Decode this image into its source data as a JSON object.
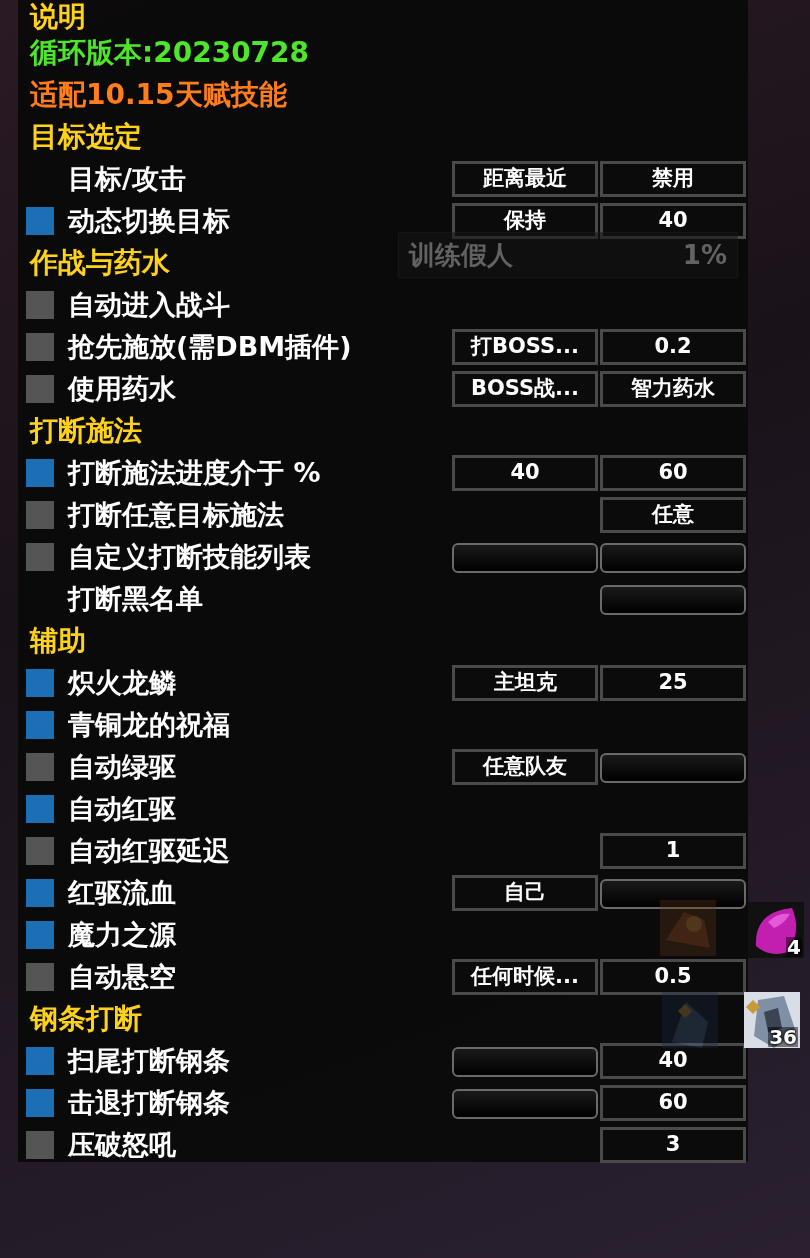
{
  "header_lines": [
    {
      "text": "说明",
      "kind": "title"
    },
    {
      "text": "循环版本:20230728",
      "kind": "version"
    },
    {
      "text": "适配10.15天赋技能",
      "kind": "note"
    }
  ],
  "sections": [
    {
      "title": "目标选定",
      "rows": [
        {
          "label": "目标/攻击",
          "controls": [
            {
              "kind": "box",
              "text": "距离最近"
            },
            {
              "kind": "box",
              "text": "禁用"
            }
          ]
        },
        {
          "label": "动态切换目标",
          "checked": true,
          "controls": [
            {
              "kind": "box",
              "text": "保持"
            },
            {
              "kind": "box",
              "text": "40"
            }
          ]
        }
      ]
    },
    {
      "title": "作战与药水",
      "rows": [
        {
          "label": "自动进入战斗",
          "checked": false,
          "controls": []
        },
        {
          "label": "抢先施放(需DBM插件)",
          "checked": false,
          "controls": [
            {
              "kind": "box",
              "text": "打BOSS..."
            },
            {
              "kind": "box",
              "text": "0.2"
            }
          ]
        },
        {
          "label": "使用药水",
          "checked": false,
          "controls": [
            {
              "kind": "box",
              "text": "BOSS战..."
            },
            {
              "kind": "box",
              "text": "智力药水"
            }
          ]
        }
      ]
    },
    {
      "title": "打断施法",
      "rows": [
        {
          "label": "打断施法进度介于 %",
          "checked": true,
          "controls": [
            {
              "kind": "box",
              "text": "40"
            },
            {
              "kind": "box",
              "text": "60"
            }
          ]
        },
        {
          "label": "打断任意目标施法",
          "checked": false,
          "controls": [
            {
              "kind": "none"
            },
            {
              "kind": "box",
              "text": "任意"
            }
          ]
        },
        {
          "label": "自定义打断技能列表",
          "checked": false,
          "controls": [
            {
              "kind": "bar"
            },
            {
              "kind": "bar"
            }
          ]
        },
        {
          "label": "打断黑名单",
          "controls": [
            {
              "kind": "none"
            },
            {
              "kind": "bar"
            }
          ]
        }
      ]
    },
    {
      "title": "辅助",
      "rows": [
        {
          "label": "炽火龙鳞",
          "checked": true,
          "controls": [
            {
              "kind": "box",
              "text": "主坦克"
            },
            {
              "kind": "box",
              "text": "25"
            }
          ]
        },
        {
          "label": "青铜龙的祝福",
          "checked": true,
          "controls": []
        },
        {
          "label": "自动绿驱",
          "checked": false,
          "controls": [
            {
              "kind": "box",
              "text": "任意队友"
            },
            {
              "kind": "bar"
            }
          ]
        },
        {
          "label": "自动红驱",
          "checked": true,
          "controls": []
        },
        {
          "label": "自动红驱延迟",
          "checked": false,
          "controls": [
            {
              "kind": "none"
            },
            {
              "kind": "box",
              "text": "1"
            }
          ]
        },
        {
          "label": "红驱流血",
          "checked": true,
          "controls": [
            {
              "kind": "box",
              "text": "自己"
            },
            {
              "kind": "bar"
            }
          ]
        },
        {
          "label": "魔力之源",
          "checked": true,
          "controls": []
        },
        {
          "label": "自动悬空",
          "checked": false,
          "controls": [
            {
              "kind": "box",
              "text": "任何时候..."
            },
            {
              "kind": "box",
              "text": "0.5"
            }
          ]
        }
      ]
    },
    {
      "title": "钢条打断",
      "rows": [
        {
          "label": "扫尾打断钢条",
          "checked": true,
          "controls": [
            {
              "kind": "bar"
            },
            {
              "kind": "box",
              "text": "40"
            }
          ]
        },
        {
          "label": "击退打断钢条",
          "checked": true,
          "controls": [
            {
              "kind": "bar"
            },
            {
              "kind": "box",
              "text": "60"
            }
          ]
        },
        {
          "label": "压破怒吼",
          "checked": false,
          "controls": [
            {
              "kind": "none"
            },
            {
              "kind": "box",
              "text": "3"
            }
          ]
        }
      ]
    }
  ],
  "target_frame": {
    "name": "训练假人",
    "health": "1%"
  },
  "auras": [
    {
      "faded": true
    },
    {
      "faded": false,
      "count": "4"
    },
    {
      "faded": true
    },
    {
      "faded": false,
      "count": "36"
    }
  ]
}
